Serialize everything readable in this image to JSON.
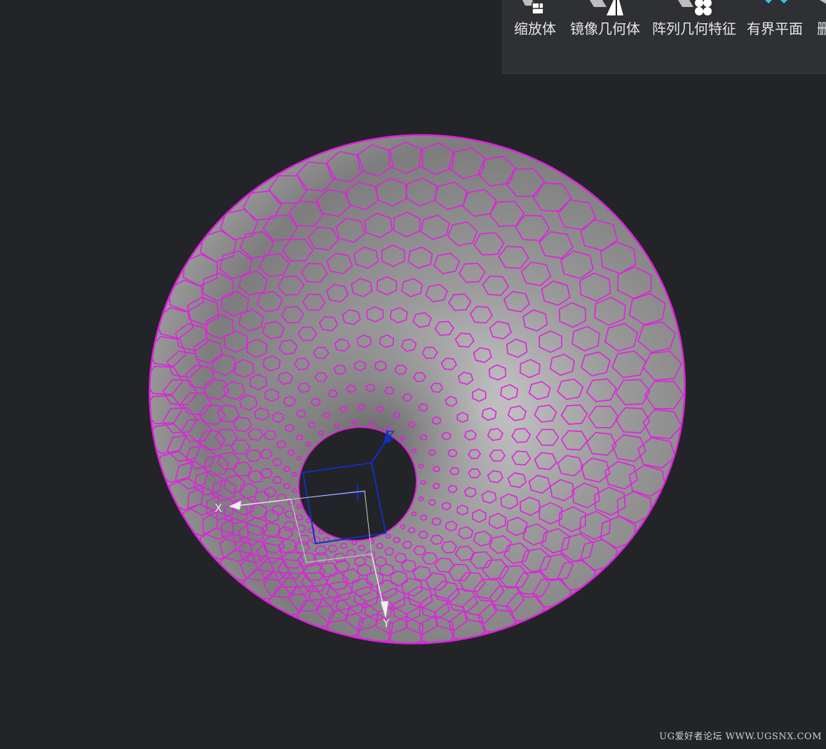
{
  "toolbar": {
    "items": [
      {
        "label": "缩放体",
        "icon": "scale-body-icon"
      },
      {
        "label": "镜像几何体",
        "icon": "mirror-geometry-icon"
      },
      {
        "label": "阵列几何特征",
        "icon": "pattern-geometry-icon"
      },
      {
        "label": "有界平面",
        "icon": "bounded-plane-icon"
      },
      {
        "label": "删",
        "icon": "delete-icon"
      }
    ]
  },
  "viewport": {
    "axes": {
      "x": "X",
      "y": "Y",
      "z": "Z"
    },
    "colors": {
      "background": "#232427",
      "surface": "#9a9a9a",
      "curves": "#e020e0",
      "csys": "#1030c0",
      "triad": "#e8e8e8"
    }
  },
  "watermark": "UG爱好者论坛 WWW.UGSNX.COM"
}
